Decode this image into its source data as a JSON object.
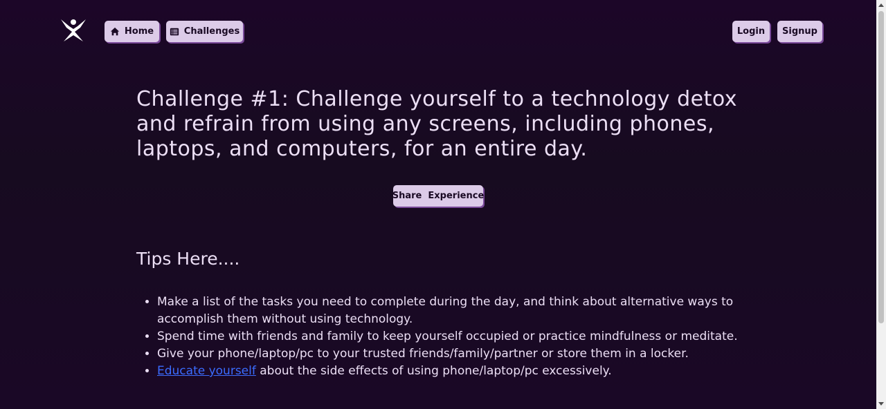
{
  "nav": {
    "home_label": "Home",
    "challenges_label": "Challenges",
    "login_label": "Login",
    "signup_label": "Signup"
  },
  "challenge": {
    "title": "Challenge #1: Challenge yourself to a technology detox and refrain from using any screens, including phones, laptops, and computers, for an entire day.",
    "share_label": "Share  Experience"
  },
  "tips": {
    "heading": "Tips Here....",
    "items": [
      "Make a list of the tasks you need to complete during the day, and think about alternative ways to accomplish them without using technology.",
      "Spend time with friends and family to keep yourself occupied or practice mindfulness or meditate.",
      "Give your phone/laptop/pc to your trusted friends/family/partner or store them in a locker."
    ],
    "last_item_link": "Educate yourself",
    "last_item_rest": " about the side effects of using phone/laptop/pc excessively."
  },
  "colors": {
    "background": "#1c0628",
    "button_bg": "#dccbe8",
    "button_shadow": "#7a4a9a",
    "text": "#ecdff5",
    "link": "#3b6cff"
  }
}
